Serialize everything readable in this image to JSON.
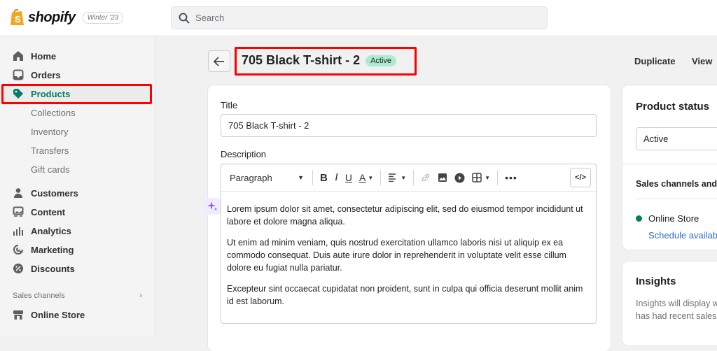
{
  "topbar": {
    "brand": "shopify",
    "release_badge": "Winter '23",
    "search_placeholder": "Search"
  },
  "sidebar": {
    "items": [
      {
        "label": "Home",
        "icon": "home-icon"
      },
      {
        "label": "Orders",
        "icon": "inbox-icon"
      },
      {
        "label": "Products",
        "icon": "tag-icon",
        "active": true
      },
      {
        "label": "Collections"
      },
      {
        "label": "Inventory"
      },
      {
        "label": "Transfers"
      },
      {
        "label": "Gift cards"
      },
      {
        "label": "Customers",
        "icon": "person-icon"
      },
      {
        "label": "Content",
        "icon": "content-icon"
      },
      {
        "label": "Analytics",
        "icon": "bar-chart-icon"
      },
      {
        "label": "Marketing",
        "icon": "target-icon"
      },
      {
        "label": "Discounts",
        "icon": "discount-icon"
      }
    ],
    "sales_channels_label": "Sales channels",
    "online_store": "Online Store"
  },
  "header": {
    "title": "705 Black T-shirt - 2",
    "status": "Active",
    "actions": [
      "Duplicate",
      "View"
    ]
  },
  "form": {
    "title_label": "Title",
    "title_value": "705 Black T-shirt - 2",
    "description_label": "Description",
    "toolbar": {
      "format": "Paragraph",
      "bold": "B",
      "italic": "I",
      "underline": "U",
      "color": "A",
      "code": "</>"
    },
    "paragraphs": [
      "Lorem ipsum dolor sit amet, consectetur adipiscing elit, sed do eiusmod tempor incididunt ut labore et dolore magna aliqua.",
      "Ut enim ad minim veniam, quis nostrud exercitation ullamco laboris nisi ut aliquip ex ea commodo consequat. Duis aute irure dolor in reprehenderit in voluptate velit esse cillum dolore eu fugiat nulla pariatur.",
      "Excepteur sint occaecat cupidatat non proident, sunt in culpa qui officia deserunt mollit anim id est laborum."
    ]
  },
  "status_card": {
    "title": "Product status",
    "value": "Active",
    "channels_heading": "Sales channels and a",
    "channel": "Online Store",
    "schedule_link": "Schedule availabi"
  },
  "insights": {
    "title": "Insights",
    "line1": "Insights will display w",
    "line2": "has had recent sales"
  },
  "colors": {
    "accent": "#008060",
    "highlight": "#ff0000",
    "badge": "#aee9d1",
    "link": "#2c6ecb"
  }
}
